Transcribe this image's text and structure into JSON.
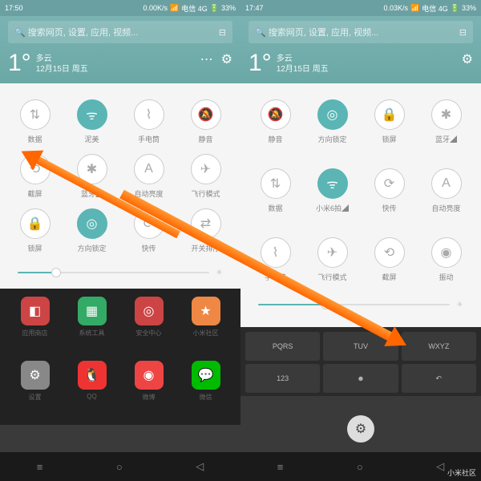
{
  "left": {
    "status": {
      "time": "17:50",
      "net": "0.00K/s",
      "sig": "电信 4G",
      "bat": "33%"
    },
    "search": "搜索网页, 设置, 应用, 视频...",
    "weather": {
      "deg": "1°",
      "cond": "多云",
      "date": "12月15日 周五"
    },
    "toggles": [
      {
        "icon": "⇅",
        "label": "数据",
        "on": false
      },
      {
        "icon": "ᯤ",
        "label": "泥美",
        "on": true
      },
      {
        "icon": "⌇",
        "label": "手电筒",
        "on": false
      },
      {
        "icon": "🔕",
        "label": "静音",
        "on": false
      },
      {
        "icon": "⟲",
        "label": "截屏",
        "on": false
      },
      {
        "icon": "✱",
        "label": "蓝牙◢",
        "on": false
      },
      {
        "icon": "A",
        "label": "自动亮度",
        "on": false
      },
      {
        "icon": "✈",
        "label": "飞行模式",
        "on": false
      },
      {
        "icon": "🔒",
        "label": "锁屏",
        "on": false
      },
      {
        "icon": "◎",
        "label": "方向锁定",
        "on": true
      },
      {
        "icon": "⟳",
        "label": "快传",
        "on": false
      },
      {
        "icon": "⇄",
        "label": "开关排序",
        "on": false
      }
    ],
    "slider": 20,
    "apps": [
      {
        "bg": "#c44",
        "icon": "◧",
        "label": "应用商店"
      },
      {
        "bg": "#3a6",
        "icon": "▦",
        "label": "系统工具"
      },
      {
        "bg": "#c44",
        "icon": "◎",
        "label": "安全中心"
      },
      {
        "bg": "#e84",
        "icon": "★",
        "label": "小米社区"
      },
      {
        "bg": "#888",
        "icon": "⚙",
        "label": "设置"
      },
      {
        "bg": "#e33",
        "icon": "🐧",
        "label": "QQ"
      },
      {
        "bg": "#e44",
        "icon": "◉",
        "label": "微博"
      },
      {
        "bg": "#0b0",
        "icon": "💬",
        "label": "微信"
      }
    ]
  },
  "right": {
    "status": {
      "time": "17:47",
      "net": "0.03K/s",
      "sig": "电信 4G",
      "bat": "33%"
    },
    "search": "搜索网页, 设置, 应用, 视频...",
    "weather": {
      "deg": "1°",
      "cond": "多云",
      "date": "12月15日 周五"
    },
    "toggles": [
      {
        "icon": "🔕",
        "label": "静音",
        "on": false
      },
      {
        "icon": "◎",
        "label": "方向锁定",
        "on": true
      },
      {
        "icon": "🔒",
        "label": "锁屏",
        "on": false
      },
      {
        "icon": "✱",
        "label": "蓝牙◢",
        "on": false
      },
      {
        "icon": "⇅",
        "label": "数据",
        "on": false
      },
      {
        "icon": "ᯤ",
        "label": "小米6拍◢",
        "on": true
      },
      {
        "icon": "⟳",
        "label": "快传",
        "on": false
      },
      {
        "icon": "A",
        "label": "自动亮度",
        "on": false
      },
      {
        "icon": "⌇",
        "label": "手电筒",
        "on": false
      },
      {
        "icon": "✈",
        "label": "飞行模式",
        "on": false
      },
      {
        "icon": "⟲",
        "label": "截屏",
        "on": false
      },
      {
        "icon": "◉",
        "label": "振动",
        "on": false
      }
    ],
    "slider": 35,
    "keys": [
      "PQRS",
      "TUV",
      "WXYZ",
      "123",
      "☻",
      "↶"
    ]
  },
  "watermark": "小米社区"
}
